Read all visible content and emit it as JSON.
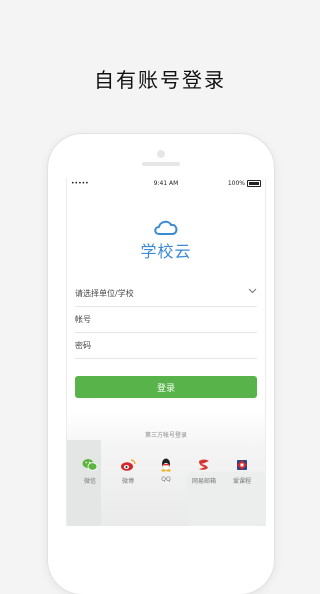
{
  "headline": "自有账号登录",
  "status_bar": {
    "carrier": "•••••",
    "time": "9:41 AM",
    "battery": "100%"
  },
  "logo": {
    "text": "学校云",
    "color": "#3a8ad5"
  },
  "form": {
    "school_select": "请选择单位/学校",
    "account": "帐号",
    "password": "密码",
    "login_button": "登录"
  },
  "third_party": {
    "title": "第三方帐号登录",
    "items": [
      {
        "label": "微信",
        "icon": "wechat-icon",
        "color": "#5db540"
      },
      {
        "label": "微博",
        "icon": "weibo-icon",
        "color": "#d7262b"
      },
      {
        "label": "QQ",
        "icon": "qq-icon",
        "color": "#222222"
      },
      {
        "label": "网易邮箱",
        "icon": "netease-mail-icon",
        "color": "#d8322d"
      },
      {
        "label": "爱课程",
        "icon": "icourse-icon",
        "color": "#d7262b"
      }
    ]
  },
  "colors": {
    "accent_green": "#58b44a",
    "brand_blue": "#3a8ad5"
  }
}
